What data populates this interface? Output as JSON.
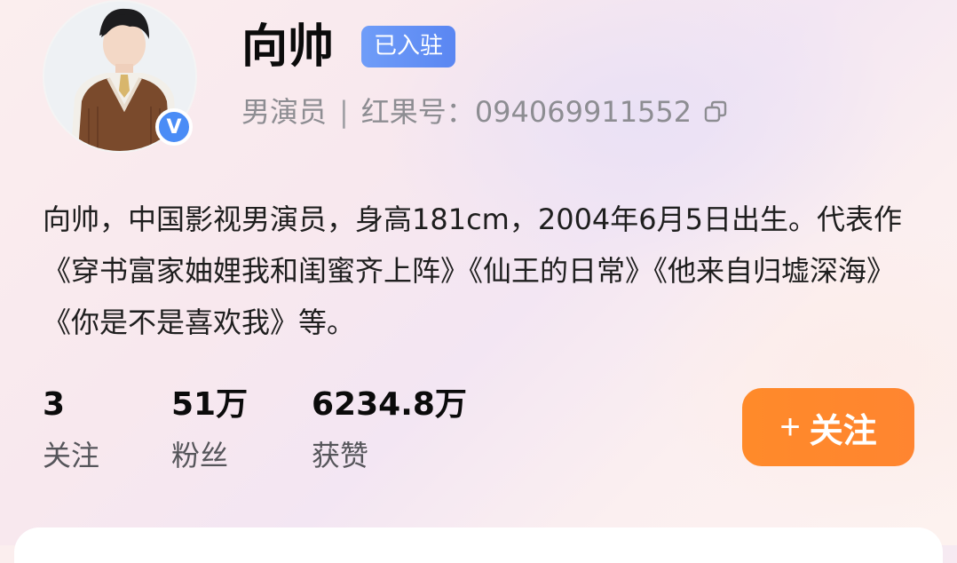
{
  "profile": {
    "name": "向帅",
    "badge": "已入驻",
    "role": "男演员",
    "separator": "|",
    "id_label": "红果号：",
    "id_value": "094069911552",
    "verified_mark": "V",
    "bio": "向帅，中国影视男演员，身高181cm，2004年6月5日出生。代表作《穿书富家妯娌我和闺蜜齐上阵》《仙王的日常》《他来自归墟深海》《你是不是喜欢我》等。"
  },
  "stats": [
    {
      "value": "3",
      "label": "关注"
    },
    {
      "value": "51万",
      "label": "粉丝"
    },
    {
      "value": "6234.8万",
      "label": "获赞"
    }
  ],
  "follow_button": {
    "plus": "+",
    "label": "关注"
  },
  "colors": {
    "accent_orange": "#ff8a2a",
    "verified_blue": "#4a8cf6",
    "badge_blue": "#6f9df8"
  },
  "icons": {
    "copy": "copy-icon",
    "verified": "verified-icon",
    "plus": "plus-icon"
  }
}
